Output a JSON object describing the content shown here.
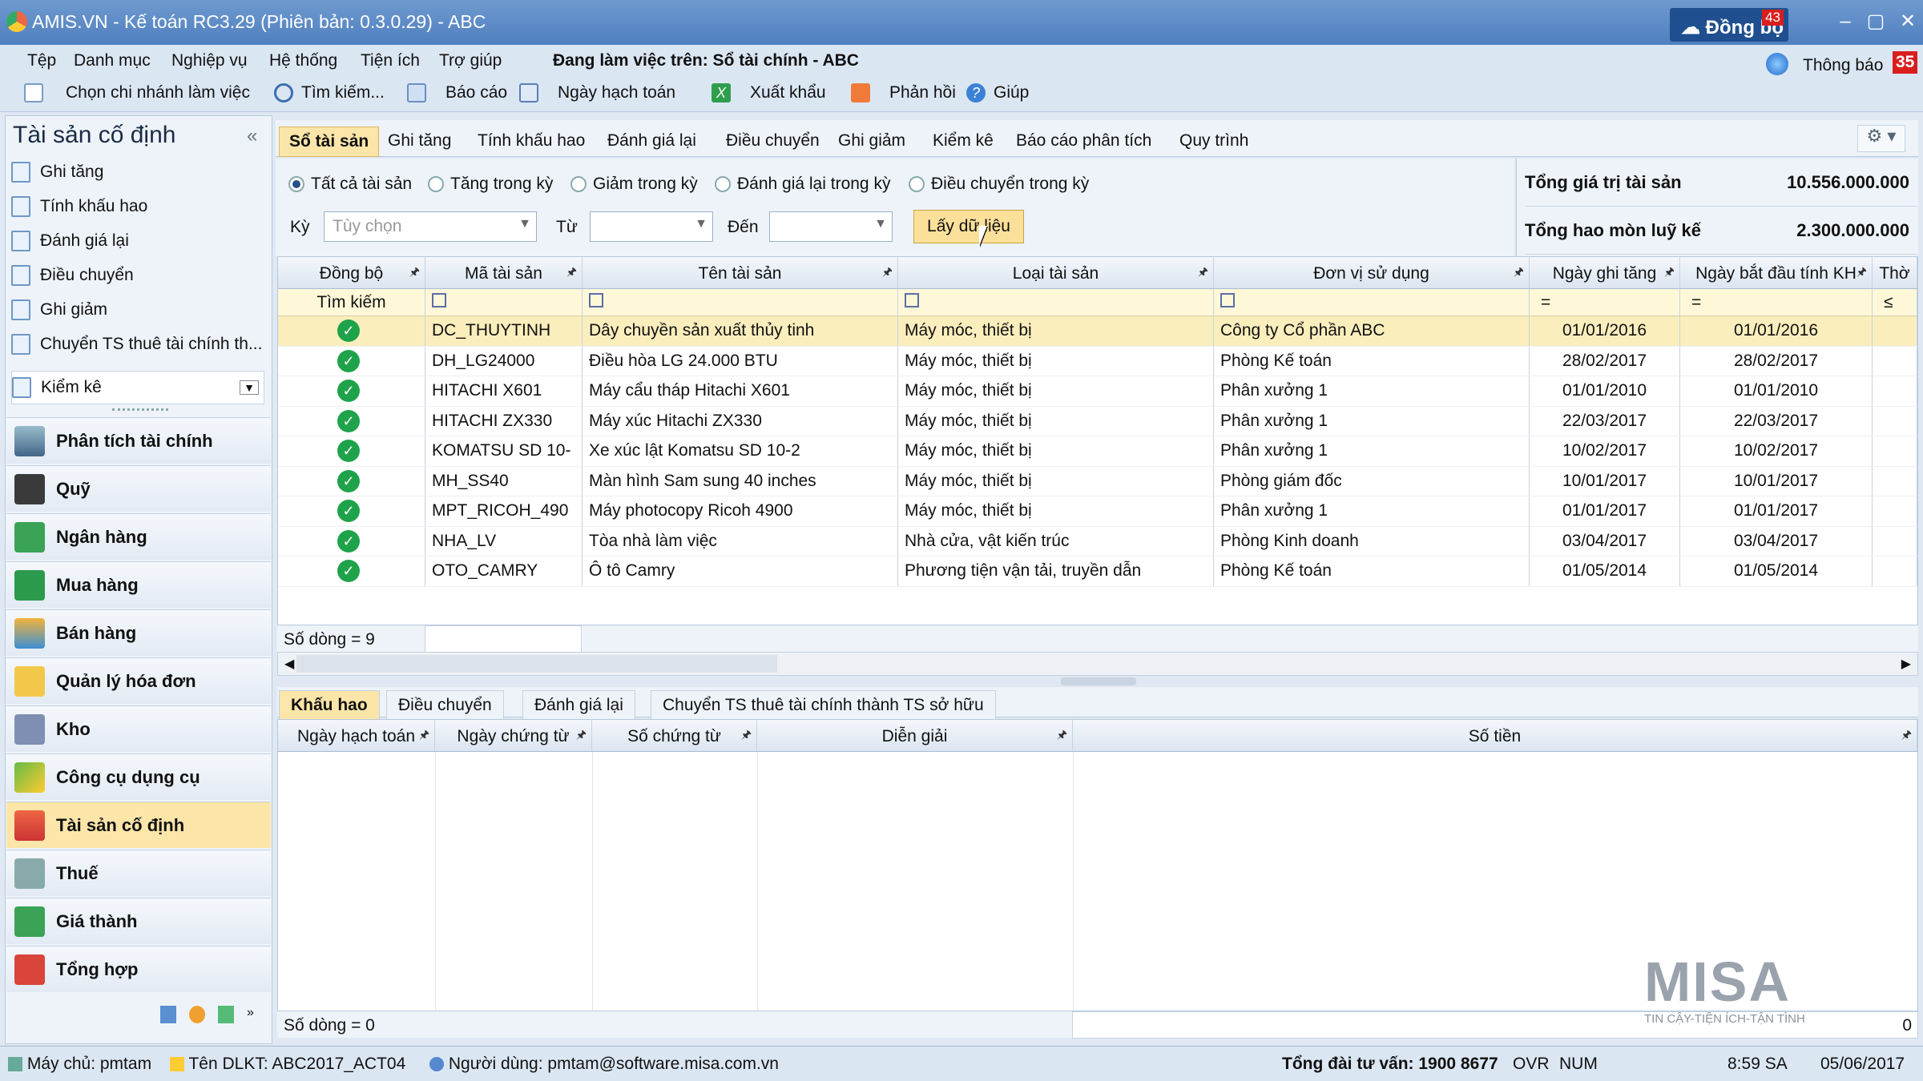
{
  "window": {
    "title": "AMIS.VN - Kế toán RC3.29 (Phiên bản: 0.3.0.29) - ABC",
    "sync_label": "Đồng bộ",
    "sync_count": "43"
  },
  "menu": {
    "items": [
      "Tệp",
      "Danh mục",
      "Nghiệp vụ",
      "Hệ thống",
      "Tiện ích",
      "Trợ giúp"
    ],
    "workspace": "Đang làm việc trên: Sổ tài chính - ABC",
    "notify_label": "Thông báo",
    "notify_count": "35"
  },
  "toolbar": {
    "items": [
      "Chọn chi nhánh làm việc",
      "Tìm kiếm...",
      "Báo cáo",
      "Ngày hạch toán",
      "Xuất khẩu",
      "Phản hồi",
      "Giúp"
    ]
  },
  "sidebar": {
    "title": "Tài sản cố định",
    "actions": [
      "Ghi tăng",
      "Tính khấu hao",
      "Đánh giá lại",
      "Điều chuyển",
      "Ghi giảm",
      "Chuyển TS thuê tài chính th...",
      "Kiểm kê"
    ],
    "modules": [
      "Phân tích tài chính",
      "Quỹ",
      "Ngân hàng",
      "Mua hàng",
      "Bán hàng",
      "Quản lý hóa đơn",
      "Kho",
      "Công cụ dụng cụ",
      "Tài sản cố định",
      "Thuế",
      "Giá thành",
      "Tổng hợp"
    ],
    "active_module": "Tài sản cố định"
  },
  "tabs": [
    "Sổ tài sản",
    "Ghi tăng",
    "Tính khấu hao",
    "Đánh giá lại",
    "Điều chuyển",
    "Ghi giảm",
    "Kiểm kê",
    "Báo cáo phân tích",
    "Quy trình"
  ],
  "filters": {
    "radios": [
      "Tất cả tài sản",
      "Tăng trong kỳ",
      "Giảm trong kỳ",
      "Đánh giá lại trong kỳ",
      "Điều chuyển trong kỳ"
    ],
    "selected": "Tất cả tài sản",
    "ky_label": "Kỳ",
    "ky_value": "Tùy chọn",
    "tu_label": "Từ",
    "den_label": "Đến",
    "fetch_button": "Lấy dữ liệu"
  },
  "totals": {
    "asset_label": "Tổng giá trị tài sản",
    "asset_value": "10.556.000.000",
    "dep_label": "Tổng hao mòn luỹ kế",
    "dep_value": "2.300.000.000"
  },
  "grid": {
    "columns": [
      "Đồng bộ",
      "Mã tài sản",
      "Tên tài sản",
      "Loại tài sản",
      "Đơn vị sử dụng",
      "Ngày ghi tăng",
      "Ngày bắt đầu tính KH",
      "Thờ"
    ],
    "search_label": "Tìm kiếm",
    "rows": [
      [
        "DC_THUYTINH",
        "Dây chuyền sản xuất thủy tinh",
        "Máy móc, thiết bị",
        "Công ty Cổ phần ABC",
        "01/01/2016",
        "01/01/2016"
      ],
      [
        "DH_LG24000",
        "Điều hòa LG 24.000 BTU",
        "Máy móc, thiết bị",
        "Phòng Kế toán",
        "28/02/2017",
        "28/02/2017"
      ],
      [
        "HITACHI X601",
        "Máy cẩu tháp Hitachi X601",
        "Máy móc, thiết bị",
        "Phân xưởng 1",
        "01/01/2010",
        "01/01/2010"
      ],
      [
        "HITACHI ZX330",
        "Máy xúc Hitachi ZX330",
        "Máy móc, thiết bị",
        "Phân xưởng 1",
        "22/03/2017",
        "22/03/2017"
      ],
      [
        "KOMATSU SD 10-",
        "Xe xúc lật Komatsu SD 10-2",
        "Máy móc, thiết bị",
        "Phân xưởng 1",
        "10/02/2017",
        "10/02/2017"
      ],
      [
        "MH_SS40",
        "Màn hình Sam sung 40 inches",
        "Máy móc, thiết bị",
        "Phòng giám đốc",
        "10/01/2017",
        "10/01/2017"
      ],
      [
        "MPT_RICOH_490",
        "Máy photocopy Ricoh 4900",
        "Máy móc, thiết bị",
        "Phân xưởng 1",
        "01/01/2017",
        "01/01/2017"
      ],
      [
        "NHA_LV",
        "Tòa nhà làm việc",
        "Nhà cửa, vật kiến trúc",
        "Phòng Kinh doanh",
        "03/04/2017",
        "03/04/2017"
      ],
      [
        "OTO_CAMRY",
        "Ô tô Camry",
        "Phương tiện vận tải, truyền dẫn",
        "Phòng Kế toán",
        "01/05/2014",
        "01/05/2014"
      ]
    ],
    "row_count": "Số dòng = 9"
  },
  "bottom": {
    "tabs": [
      "Khấu hao",
      "Điều chuyển",
      "Đánh giá lại",
      "Chuyển TS thuê tài chính thành TS sở hữu"
    ],
    "columns": [
      "Ngày hạch toán",
      "Ngày chứng từ",
      "Số chứng từ",
      "Diễn giải",
      "Số tiền"
    ],
    "row_count": "Số dòng = 0",
    "total": "0"
  },
  "status": {
    "server": "Máy chủ: pmtam",
    "db": "Tên DLKT: ABC2017_ACT04",
    "user": "Người dùng: pmtam@software.misa.com.vn",
    "hotline": "Tổng đài tư vấn: 1900 8677",
    "ovr": "OVR",
    "num": "NUM",
    "time": "8:59 SA",
    "date": "05/06/2017"
  },
  "brand": {
    "logo": "MISA",
    "tagline": "TIN CẬY-TIỆN ÍCH-TẬN TÌNH"
  },
  "colors": {
    "accent": "#fbe5a8",
    "title_bar": "#4f7fbe",
    "check": "#1ea34a"
  }
}
